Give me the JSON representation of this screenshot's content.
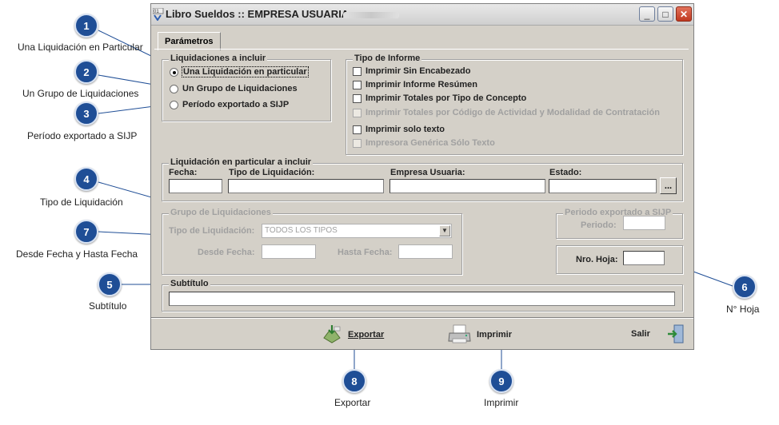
{
  "window": {
    "title": "Libro Sueldos :: EMPRESA USUARIA:",
    "tab": "Parámetros",
    "minimize_label": "_",
    "maximize_label": "□",
    "close_label": "✕"
  },
  "liquidaciones": {
    "legend": "Liquidaciones a incluir",
    "options": [
      "Una Liquidación en particular",
      "Un Grupo de Liquidaciones",
      "Período exportado a SIJP"
    ]
  },
  "tipo_informe": {
    "legend": "Tipo de Informe",
    "options": [
      "Imprimir Sin Encabezado",
      "Imprimir Informe Resúmen",
      "Imprimir Totales por Tipo de Concepto",
      "Imprimir Totales por Código de Actividad y Modalidad de Contratación",
      "Imprimir solo texto",
      "Impresora Genérica Sólo Texto"
    ]
  },
  "particular": {
    "legend": "Liquidación en particular a incluir",
    "fecha": "Fecha:",
    "tipo": "Tipo de Liquidación:",
    "empresa": "Empresa Usuaria:",
    "estado": "Estado:",
    "browse_label": "..."
  },
  "grupo": {
    "legend": "Grupo de Liquidaciones",
    "tipo_label": "Tipo de Liquidación:",
    "tipo_value": "TODOS LOS TIPOS",
    "desde": "Desde Fecha:",
    "hasta": "Hasta Fecha:"
  },
  "periodo": {
    "legend": "Periodo exportado a SIJP",
    "label": "Periodo:"
  },
  "hoja": {
    "label": "Nro. Hoja:"
  },
  "subtitulo": {
    "legend": "Subtítulo"
  },
  "actions": {
    "exportar": "Exportar",
    "imprimir": "Imprimir",
    "salir": "Salir"
  },
  "callouts": [
    {
      "n": "1",
      "label": "Una Liquidación en Particular"
    },
    {
      "n": "2",
      "label": "Un Grupo de Liquidaciones"
    },
    {
      "n": "3",
      "label": "Período exportado a SIJP"
    },
    {
      "n": "4",
      "label": "Tipo de Liquidación"
    },
    {
      "n": "7",
      "label": "Desde Fecha y Hasta Fecha"
    },
    {
      "n": "5",
      "label": "Subtítulo"
    },
    {
      "n": "6",
      "label": "N° Hoja"
    },
    {
      "n": "8",
      "label": "Exportar"
    },
    {
      "n": "9",
      "label": "Imprimir"
    }
  ]
}
